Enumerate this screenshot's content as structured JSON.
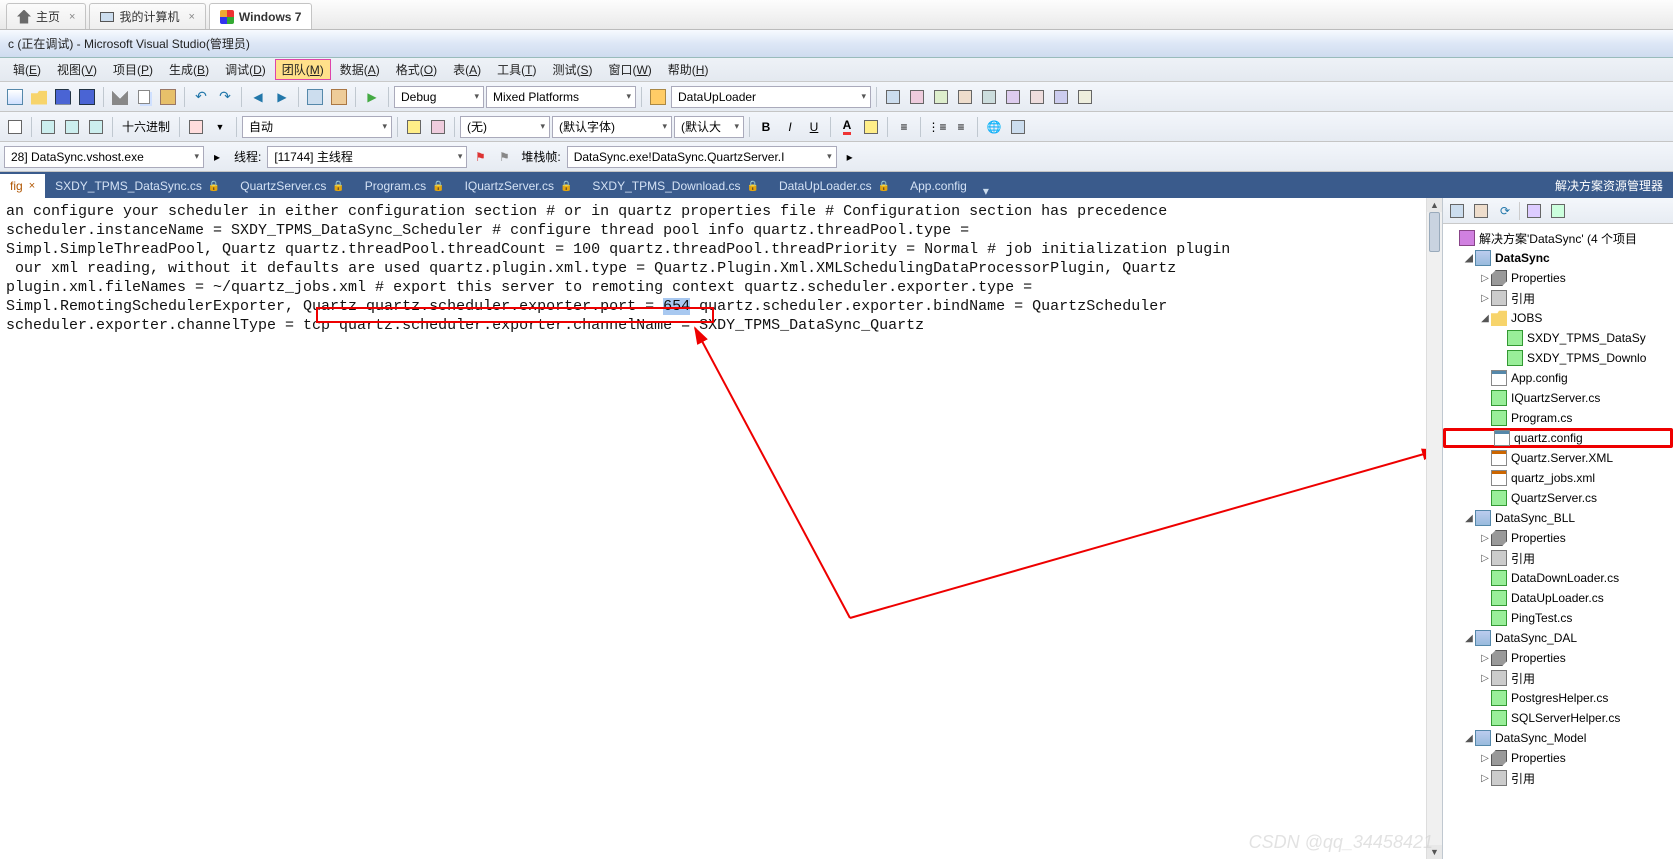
{
  "os_tabs": [
    {
      "label": "主页",
      "icon": "home",
      "closable": true
    },
    {
      "label": "我的计算机",
      "icon": "pc",
      "closable": true
    },
    {
      "label": "Windows 7",
      "icon": "win",
      "closable": false,
      "active": true
    }
  ],
  "title_bar": "c (正在调试) - Microsoft Visual Studio(管理员)",
  "menu": [
    {
      "l": "编辑",
      "u": "E"
    },
    {
      "l": "视图",
      "u": "V"
    },
    {
      "l": "项目",
      "u": "P"
    },
    {
      "l": "生成",
      "u": "B"
    },
    {
      "l": "调试",
      "u": "D"
    },
    {
      "l": "团队",
      "u": "M",
      "hl": true
    },
    {
      "l": "数据",
      "u": "A"
    },
    {
      "l": "格式",
      "u": "O"
    },
    {
      "l": "表",
      "u": "A"
    },
    {
      "l": "工具",
      "u": "T"
    },
    {
      "l": "测试",
      "u": "S"
    },
    {
      "l": "窗口",
      "u": "W"
    },
    {
      "l": "帮助",
      "u": "H"
    }
  ],
  "toolbar1": {
    "config": "Debug",
    "platform": "Mixed Platforms",
    "startup": "DataUpLoader"
  },
  "toolbar2": {
    "hex_label": "十六进制",
    "auto": "自动",
    "none": "(无)",
    "deffont": "(默认字体)",
    "defsize": "(默认大"
  },
  "toolbar3": {
    "process_prefix": "28] DataSync.vshost.exe",
    "thread_label": "线程:",
    "thread_value": "[11744] 主线程",
    "stack_label": "堆栈帧:",
    "stack_value": "DataSync.exe!DataSync.QuartzServer.I"
  },
  "doc_tabs": [
    {
      "label": "fig",
      "active": true,
      "close": true
    },
    {
      "label": "SXDY_TPMS_DataSync.cs",
      "lock": true
    },
    {
      "label": "QuartzServer.cs",
      "lock": true
    },
    {
      "label": "Program.cs",
      "lock": true
    },
    {
      "label": "IQuartzServer.cs",
      "lock": true
    },
    {
      "label": "SXDY_TPMS_Download.cs",
      "lock": true
    },
    {
      "label": "DataUpLoader.cs",
      "lock": true
    },
    {
      "label": "App.config"
    }
  ],
  "side_panel_title": "解决方案资源管理器",
  "editor_lines": [
    "an configure your scheduler in either configuration section # or in quartz properties file # Configuration section has precedence",
    "scheduler.instanceName = SXDY_TPMS_DataSync_Scheduler # configure thread pool info quartz.threadPool.type =",
    "Simpl.SimpleThreadPool, Quartz quartz.threadPool.threadCount = 100 quartz.threadPool.threadPriority = Normal # job initialization plugin",
    " our xml reading, without it defaults are used quartz.plugin.xml.type = Quartz.Plugin.Xml.XMLSchedulingDataProcessorPlugin, Quartz",
    "plugin.xml.fileNames = ~/quartz_jobs.xml # export this server to remoting context quartz.scheduler.exporter.type =",
    "Simpl.RemotingSchedulerExporter, Quartz quartz.scheduler.exporter.port = 654 quartz.scheduler.exporter.bindName = QuartzScheduler",
    "scheduler.exporter.channelType = tcp quartz.scheduler.exporter.channelName = SXDY_TPMS_DataSync_Quartz"
  ],
  "highlight_port": "654",
  "tree": {
    "solution": "解决方案'DataSync' (4 个项目",
    "proj1": "DataSync",
    "properties": "Properties",
    "references": "引用",
    "jobs": "JOBS",
    "job_files": [
      "SXDY_TPMS_DataSy",
      "SXDY_TPMS_Downlo"
    ],
    "files1": [
      "App.config",
      "IQuartzServer.cs",
      "Program.cs",
      "quartz.config",
      "Quartz.Server.XML",
      "quartz_jobs.xml",
      "QuartzServer.cs"
    ],
    "proj2": "DataSync_BLL",
    "files2": [
      "DataDownLoader.cs",
      "DataUpLoader.cs",
      "PingTest.cs"
    ],
    "proj3": "DataSync_DAL",
    "files3": [
      "PostgresHelper.cs",
      "SQLServerHelper.cs"
    ],
    "proj4": "DataSync_Model"
  },
  "watermark": "CSDN @qq_34458421"
}
